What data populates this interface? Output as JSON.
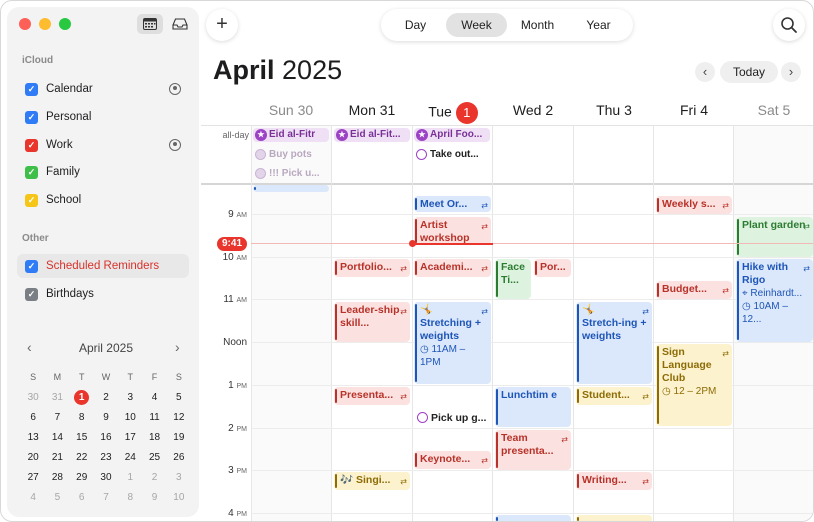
{
  "sidebar": {
    "icloud_label": "iCloud",
    "other_label": "Other",
    "icloud_calendars": [
      {
        "label": "Calendar",
        "color": "#2f7cf6",
        "shared": true
      },
      {
        "label": "Personal",
        "color": "#2f7cf6",
        "shared": false
      },
      {
        "label": "Work",
        "color": "#e9352b",
        "shared": true
      },
      {
        "label": "Family",
        "color": "#3fbf4a",
        "shared": false
      },
      {
        "label": "School",
        "color": "#f5c518",
        "shared": false
      }
    ],
    "other_calendars": [
      {
        "label": "Scheduled Reminders",
        "color": "#e9352b"
      },
      {
        "label": "Birthdays",
        "color": "#8e8e93"
      }
    ]
  },
  "mini_calendar": {
    "title": "April 2025",
    "weekdays": [
      "S",
      "M",
      "T",
      "W",
      "T",
      "F",
      "S"
    ],
    "weeks": [
      [
        "30",
        "31",
        "1",
        "2",
        "3",
        "4",
        "5"
      ],
      [
        "6",
        "7",
        "8",
        "9",
        "10",
        "11",
        "12"
      ],
      [
        "13",
        "14",
        "15",
        "16",
        "17",
        "18",
        "19"
      ],
      [
        "20",
        "21",
        "22",
        "23",
        "24",
        "25",
        "26"
      ],
      [
        "27",
        "28",
        "29",
        "30",
        "1",
        "2",
        "3"
      ],
      [
        "4",
        "5",
        "6",
        "7",
        "8",
        "9",
        "10"
      ]
    ],
    "today": "1"
  },
  "toolbar": {
    "add": "+",
    "views": [
      "Day",
      "Week",
      "Month",
      "Year"
    ],
    "active_view": "Week",
    "today": "Today",
    "prev": "‹",
    "next": "›"
  },
  "header": {
    "month": "April",
    "year": "2025"
  },
  "days": [
    {
      "label": "Sun 30",
      "weekend": true
    },
    {
      "label": "Mon 31",
      "weekend": false
    },
    {
      "label": "Tue",
      "weekend": false,
      "today_num": "1"
    },
    {
      "label": "Wed 2",
      "weekend": false
    },
    {
      "label": "Thu 3",
      "weekend": false
    },
    {
      "label": "Fri 4",
      "weekend": false
    },
    {
      "label": "Sat 5",
      "weekend": true
    }
  ],
  "allday_label": "all-day",
  "hours": [
    {
      "num": "9",
      "suffix": "AM"
    },
    {
      "num": "10",
      "suffix": "AM"
    },
    {
      "num": "11",
      "suffix": "AM"
    },
    {
      "num": "Noon",
      "suffix": ""
    },
    {
      "num": "1",
      "suffix": "PM"
    },
    {
      "num": "2",
      "suffix": "PM"
    },
    {
      "num": "3",
      "suffix": "PM"
    },
    {
      "num": "4",
      "suffix": "PM"
    }
  ],
  "now": "9:41",
  "allday_events": {
    "eid_sun": "Eid al-Fitr",
    "eid_mon": "Eid al-Fit...",
    "april_fools": "April Foo...",
    "buy_pots": "Buy pots",
    "pick_up": "!!! Pick u...",
    "take_out": "Take out..."
  },
  "events": {
    "meet": "Meet Or...",
    "artist": "Artist workshop",
    "portfolio": "Portfolio...",
    "academic": "Academi...",
    "face": "Face Ti...",
    "por": "Por...",
    "leadership": "Leader-ship skill...",
    "stretch_tue": "Stretching + weights",
    "stretch_tue_time": "11AM – 1PM",
    "stretch_thu": "Stretch-ing + weights",
    "weekly": "Weekly s...",
    "budget": "Budget...",
    "plant": "Plant garden",
    "hike": "Hike with Rigo",
    "hike_loc": "Reinhardt...",
    "hike_time": "10AM – 12...",
    "sign": "Sign Language Club",
    "sign_time": "12 – 2PM",
    "presenta": "Presenta...",
    "lunch": "Lunchtim e",
    "student": "Student...",
    "pick_up_g": "Pick up g...",
    "team": "Team presenta...",
    "keynote": "Keynote...",
    "singing": "Singi...",
    "writing": "Writing...",
    "guitar_emoji": "🎶",
    "dancer_emoji": "🤸"
  }
}
